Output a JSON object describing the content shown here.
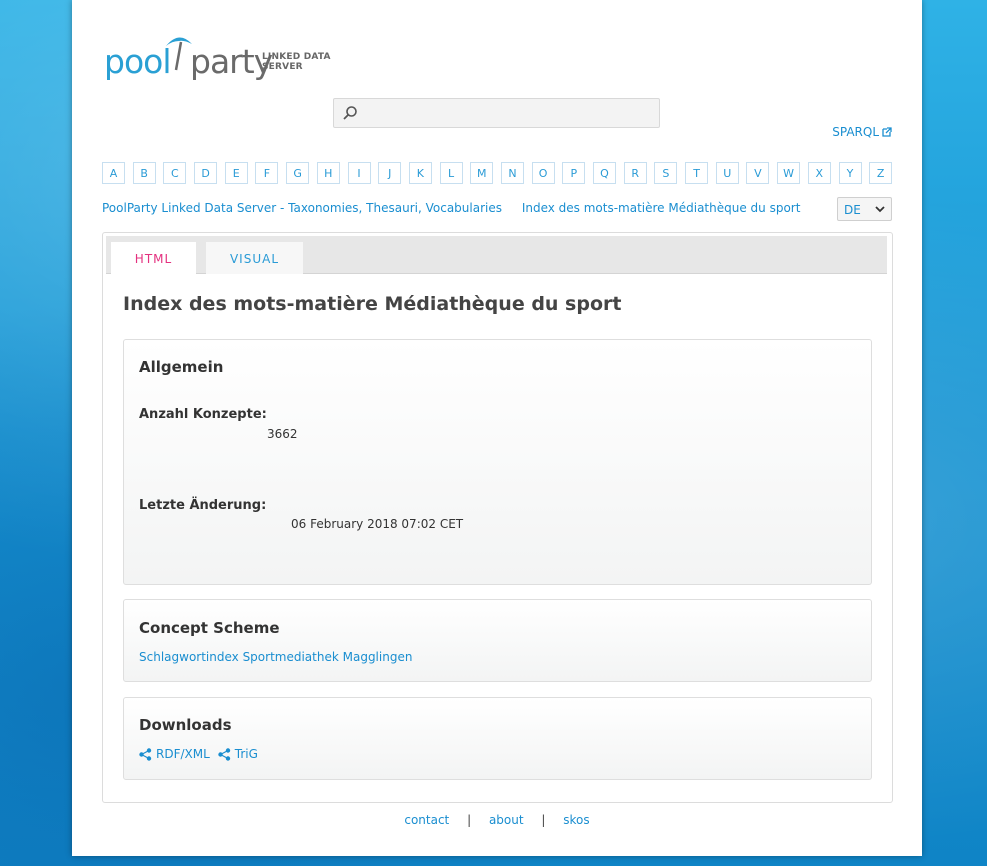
{
  "logo": {
    "word_left": "pool",
    "word_right": "party",
    "sub_line1": "LINKED DATA",
    "sub_line2": "SERVER",
    "icon": "umbrella-icon"
  },
  "search": {
    "value": "",
    "placeholder": "",
    "icon": "search-icon"
  },
  "sparql": {
    "label": "SPARQL",
    "icon": "external-link-icon"
  },
  "alphabet": [
    "A",
    "B",
    "C",
    "D",
    "E",
    "F",
    "G",
    "H",
    "I",
    "J",
    "K",
    "L",
    "M",
    "N",
    "O",
    "P",
    "Q",
    "R",
    "S",
    "T",
    "U",
    "V",
    "W",
    "X",
    "Y",
    "Z"
  ],
  "breadcrumb": {
    "items": [
      "PoolParty Linked Data Server - Taxonomies, Thesauri, Vocabularies",
      "Index des mots-matière Médiathèque du sport"
    ]
  },
  "language": {
    "selected": "DE",
    "icon": "chevron-down-icon"
  },
  "tabs": [
    {
      "label": "HTML"
    },
    {
      "label": "VISUAL"
    }
  ],
  "main": {
    "title": "Index des mots-matière Médiathèque du sport",
    "allgemein": {
      "heading": "Allgemein",
      "concepts_label": "Anzahl Konzepte:",
      "concepts_value": "3662",
      "modified_label": "Letzte Änderung:",
      "modified_value": "06 February 2018 07:02 CET"
    },
    "scheme": {
      "heading": "Concept Scheme",
      "link": "Schlagwortindex Sportmediathek Magglingen"
    },
    "downloads": {
      "heading": "Downloads",
      "items": [
        "RDF/XML",
        "TriG"
      ],
      "icon": "share-icon"
    }
  },
  "footer": {
    "links": [
      "contact",
      "about",
      "skos"
    ],
    "separator": "|"
  },
  "colors": {
    "link": "#1a8ed0",
    "active_tab": "#e4317f",
    "background": "#1a9fd8"
  }
}
